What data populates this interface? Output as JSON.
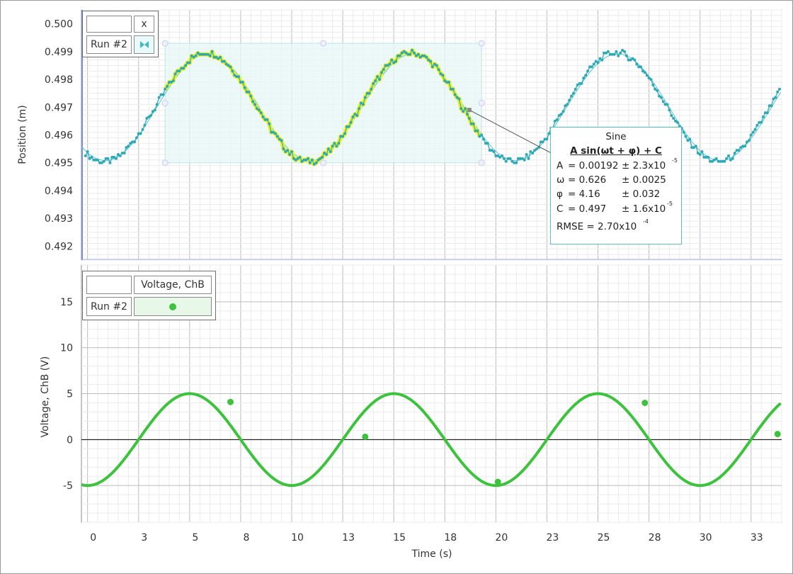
{
  "chart_data": [
    {
      "type": "scatter",
      "ylabel": "Position (m)",
      "ylim": [
        0.4915,
        0.5005
      ],
      "xlim": [
        -0.3,
        34
      ],
      "yticks": [
        "0.500",
        "0.499",
        "0.498",
        "0.497",
        "0.496",
        "0.495",
        "0.494",
        "0.493",
        "0.492"
      ],
      "grid": true,
      "legend": {
        "placement": "top-left",
        "header": "x",
        "run": "Run #2"
      },
      "series": [
        {
          "name": "x",
          "color": "#3fb8c4",
          "marker": "diamond",
          "fit_model": "sine",
          "params": {
            "A": 0.00192,
            "omega": 0.626,
            "phi": 4.16,
            "C": 0.497
          }
        }
      ],
      "selection": {
        "x_range": [
          3.8,
          19.3
        ]
      },
      "fit_box": {
        "title": "Sine",
        "formula": "A sin(ωt + φ) + C",
        "rows": [
          {
            "label": "A",
            "value": "= 0.00192",
            "unc": "± 2.3x10",
            "exp": "-5"
          },
          {
            "label": "ω",
            "value": "= 0.626",
            "unc": "± 0.0025",
            "exp": ""
          },
          {
            "label": "φ",
            "value": "= 4.16",
            "unc": "± 0.032",
            "exp": ""
          },
          {
            "label": "C",
            "value": "= 0.497",
            "unc": "± 1.6x10",
            "exp": "-5"
          }
        ],
        "rmse": "RMSE = 2.70x10",
        "rmse_exp": "-4"
      }
    },
    {
      "type": "line",
      "xlabel": "Time (s)",
      "ylabel": "Voltage, ChB (V)",
      "ylim": [
        -9,
        19
      ],
      "xlim": [
        -0.3,
        34
      ],
      "yticks": [
        "15",
        "10",
        "5",
        "0",
        "-5"
      ],
      "xticks": [
        "0",
        "3",
        "5",
        "8",
        "10",
        "13",
        "15",
        "18",
        "20",
        "23",
        "25",
        "28",
        "30",
        "33"
      ],
      "grid": true,
      "legend": {
        "placement": "top-left",
        "header": "Voltage, ChB",
        "run": "Run #2"
      },
      "series": [
        {
          "name": "Voltage, ChB",
          "color": "#3cc23c",
          "amplitude": 5.0,
          "omega": 0.6283,
          "phase": -1.5708,
          "offset": 0.0,
          "marker_points": [
            [
              7.0,
              4.1
            ],
            [
              13.6,
              0.3
            ],
            [
              20.1,
              -4.6
            ],
            [
              27.3,
              4.0
            ],
            [
              33.8,
              0.6
            ]
          ]
        }
      ]
    }
  ]
}
